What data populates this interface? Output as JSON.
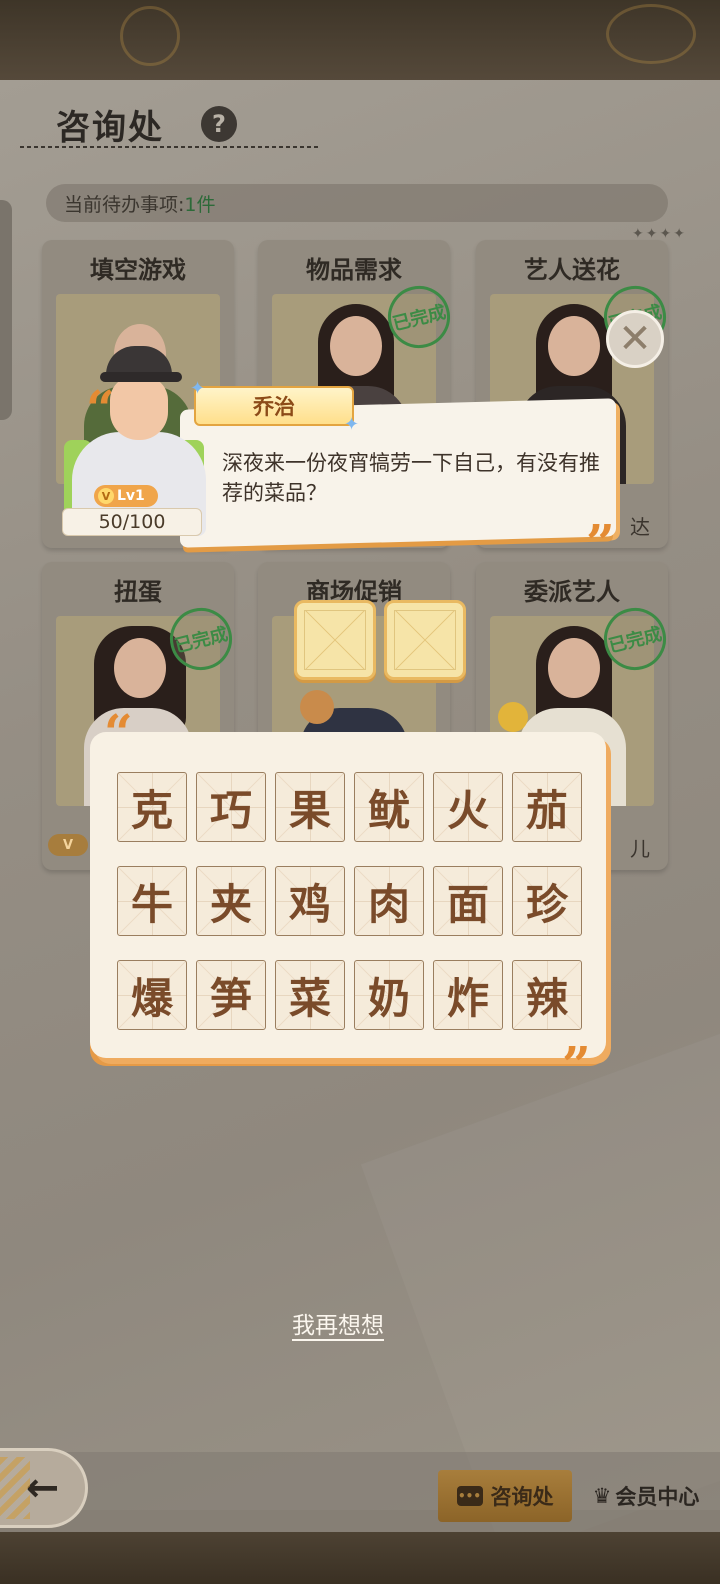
{
  "header": {
    "title": "咨询处",
    "help": "?"
  },
  "todo": {
    "label": "当前待办事项:",
    "count": "1件"
  },
  "cards": [
    {
      "title": "填空游戏",
      "completed": false,
      "footer": ""
    },
    {
      "title": "物品需求",
      "completed": true,
      "footer": ""
    },
    {
      "title": "艺人送花",
      "completed": true,
      "footer": "达"
    },
    {
      "title": "扭蛋",
      "completed": true,
      "footer": ""
    },
    {
      "title": "商场促销",
      "completed": false,
      "footer": ""
    },
    {
      "title": "委派艺人",
      "completed": true,
      "footer": "儿"
    }
  ],
  "stamp_text": "已完成",
  "npc": {
    "name": "乔治",
    "level": "Lv1",
    "level_icon": "V",
    "progress": "50/100",
    "progress_value": 0.5,
    "message": "深夜来一份夜宵犒劳一下自己，有没有推荐的菜品？"
  },
  "answer_slots": [
    "",
    ""
  ],
  "characters": [
    [
      "克",
      "巧",
      "果",
      "鱿",
      "火",
      "茄"
    ],
    [
      "牛",
      "夹",
      "鸡",
      "肉",
      "面",
      "珍"
    ],
    [
      "爆",
      "笋",
      "菜",
      "奶",
      "炸",
      "辣"
    ]
  ],
  "actions": {
    "think_again": "我再想想"
  },
  "bottom_nav": {
    "back_icon": "←",
    "consult": "咨询处",
    "member": "会员中心"
  },
  "colors": {
    "accent_orange": "#e48b33",
    "completed_green": "#3c8b45",
    "tile_text": "#7a4b2a"
  }
}
